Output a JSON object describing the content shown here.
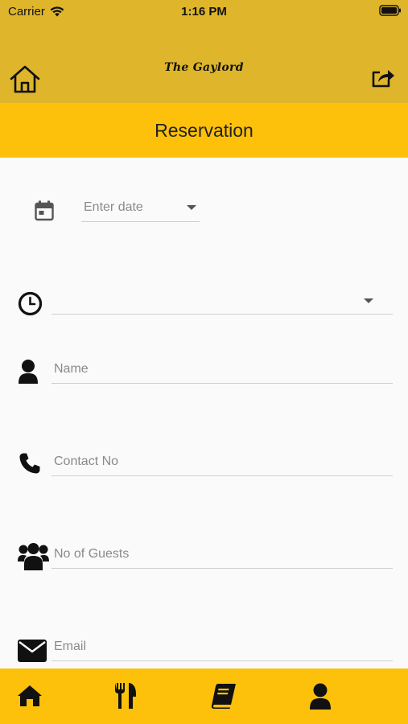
{
  "status_bar": {
    "carrier": "Carrier",
    "time": "1:16 PM"
  },
  "app_bar": {
    "brand": "The Gaylord",
    "left_icon": "home-outline-icon",
    "right_icon": "share-icon"
  },
  "page": {
    "title": "Reservation"
  },
  "form": {
    "date": {
      "placeholder": "Enter date",
      "icon": "calendar-icon"
    },
    "time": {
      "value": "",
      "icon": "clock-icon"
    },
    "name": {
      "placeholder": "Name",
      "icon": "user-icon"
    },
    "contact": {
      "placeholder": "Contact No",
      "icon": "phone-icon"
    },
    "guests": {
      "placeholder": "No of Guests",
      "icon": "users-icon"
    },
    "email": {
      "placeholder": "Email",
      "icon": "envelope-icon"
    }
  },
  "bottom_nav": {
    "items": [
      {
        "icon": "home-icon"
      },
      {
        "icon": "utensils-icon"
      },
      {
        "icon": "book-icon"
      },
      {
        "icon": "profile-icon"
      }
    ]
  },
  "colors": {
    "app_bar": "#deb52b",
    "title_bar": "#fdc10b",
    "background": "#fafafa"
  }
}
